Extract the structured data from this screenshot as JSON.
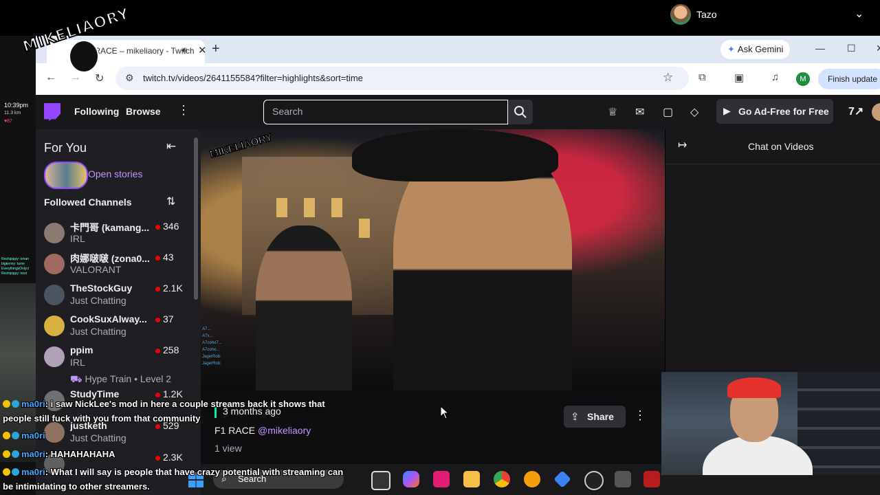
{
  "os_bar": {
    "user_name": "Tazo"
  },
  "overlay_logo": {
    "text": "MIKELIAORY"
  },
  "left_strip": {
    "time": "10:39",
    "time_suffix": "pm",
    "distance": "11.3 km",
    "heart_rate": "87",
    "mini_chat": [
      "Reshipippy: oman",
      "bigkenny: tame",
      "EverythingsOnlycl",
      "Reshipippy: next"
    ]
  },
  "browser": {
    "tab_title": "F1 RACE – mikeliaory - Twitch",
    "new_tab_symbol": "+",
    "ask_gemini": "Ask Gemini",
    "url": "twitch.tv/videos/2641155584?filter=highlights&sort=time",
    "profile_initial": "M",
    "finish_update": "Finish update"
  },
  "twitch_nav": {
    "following": "Following",
    "browse": "Browse",
    "search_placeholder": "Search",
    "ad_free": "Go Ad-Free for Free"
  },
  "sidebar": {
    "for_you": "For You",
    "open_stories": "Open stories",
    "followed_channels": "Followed Channels",
    "channels": [
      {
        "name": "卡門哥 (kamang...",
        "category": "IRL",
        "viewers": "346",
        "avatar_color": "#8a7a70"
      },
      {
        "name": "肉娜啵啵 (zona0...",
        "category": "VALORANT",
        "viewers": "43",
        "avatar_color": "#a06a60"
      },
      {
        "name": "TheStockGuy",
        "category": "Just Chatting",
        "viewers": "2.1K",
        "avatar_color": "#4a5560"
      },
      {
        "name": "CookSuxAlway...",
        "category": "Just Chatting",
        "viewers": "37",
        "avatar_color": "#d8b040"
      },
      {
        "name": "ppim",
        "category": "IRL",
        "viewers": "258",
        "avatar_color": "#b0a0b8"
      },
      {
        "name": "StudyTime",
        "category": "",
        "viewers": "1.2K",
        "avatar_color": "#707070"
      },
      {
        "name": "justketh",
        "category": "Just Chatting",
        "viewers": "529",
        "avatar_color": "#907060"
      },
      {
        "name": "",
        "category": "",
        "viewers": "2.3K",
        "avatar_color": "#606060"
      }
    ],
    "hype_train_label": "Hype Train",
    "hype_train_level": "Level 2"
  },
  "video_overlay": {
    "chat_names": [
      "A7...",
      "A7x...",
      "A7coho7...",
      "A7coho...",
      "JagerRob:",
      "JagerRob:"
    ]
  },
  "video_info": {
    "posted": "3 months ago",
    "title": "F1 RACE",
    "channel": "@mikeliaory",
    "views": "1 view",
    "share": "Share"
  },
  "chat_panel": {
    "title": "Chat on Videos"
  },
  "stream_overlay_chat": [
    {
      "user": "ma0ri",
      "message": ": i saw NickLee's mod in here a couple streams back it shows that"
    },
    {
      "user": "",
      "message": "people still fuck with you from that community"
    },
    {
      "user": "ma0ri",
      "message": ""
    },
    {
      "user": "ma0ri",
      "message": ": HAHAHAHAHA"
    },
    {
      "user": "ma0ri",
      "message": ": What I will say is people that have crazy potential with streaming can"
    },
    {
      "user": "",
      "message": "be intimidating to other streamers."
    }
  ],
  "taskbar": {
    "search": "Search"
  },
  "colors": {
    "twitch_purple": "#9147ff",
    "live_red": "#eb0400",
    "chrome_tab_bg": "#dfe7f5"
  }
}
